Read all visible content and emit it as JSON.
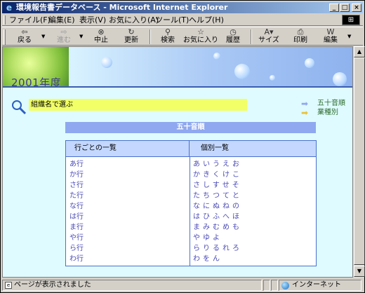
{
  "window": {
    "title": "環境報告書データベース - Microsoft Internet Explorer",
    "controls": {
      "minimize": "_",
      "maximize": "□",
      "close": "×"
    }
  },
  "menu": {
    "items": [
      "ファイル(F)",
      "編集(E)",
      "表示(V)",
      "お気に入り(A)",
      "ツール(T)",
      "ヘルプ(H)"
    ]
  },
  "toolbar": {
    "back": "戻る",
    "forward": "進む",
    "stop": "中止",
    "refresh": "更新",
    "search": "検索",
    "favorites": "お気に入り",
    "history": "履歴",
    "size": "サイズ",
    "print": "印刷",
    "edit": "編集"
  },
  "page": {
    "banner_title": "2001年度",
    "search_label": "組織名で選ぶ",
    "nav_links": [
      "五十音順",
      "業種別"
    ],
    "table_title": "五十音順",
    "table": {
      "headers": [
        "行ごとの一覧",
        "個別一覧"
      ],
      "rows_left": [
        "あ行",
        "か行",
        "さ行",
        "た行",
        "な行",
        "は行",
        "ま行",
        "や行",
        "ら行",
        "わ行"
      ],
      "rows_right": [
        "あいうえお",
        "かきくけこ",
        "さしすせそ",
        "たちつてと",
        "なにぬねの",
        "はひふへほ",
        "まみむめも",
        "やゆよ",
        "らりるれろ",
        "わをん"
      ]
    }
  },
  "status": {
    "text": "ページが表示されました",
    "zone": "インターネット"
  }
}
